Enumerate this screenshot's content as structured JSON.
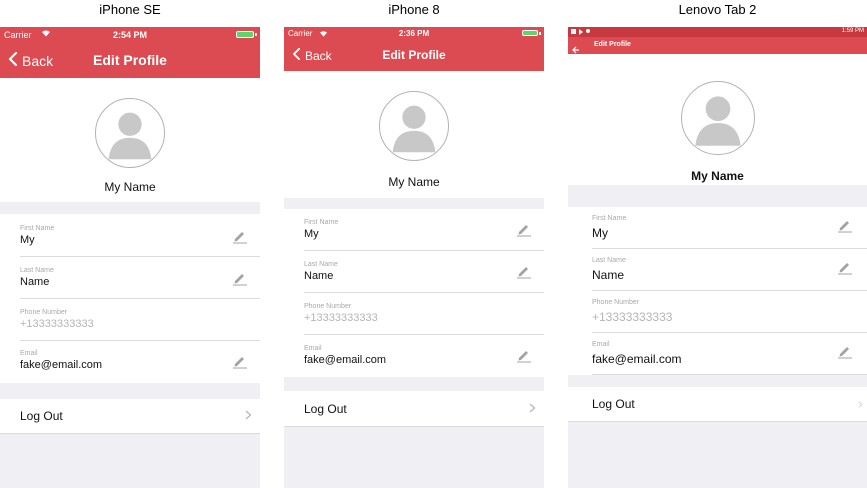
{
  "devices": [
    {
      "name": "iPhone SE",
      "status": {
        "carrier": "Carrier",
        "time": "2:54 PM"
      },
      "nav": {
        "back_label": "Back",
        "title": "Edit Profile"
      },
      "profile_name": "My Name",
      "fields": [
        {
          "label": "First Name",
          "value": "My",
          "editable": true
        },
        {
          "label": "Last Name",
          "value": "Name",
          "editable": true
        },
        {
          "label": "Phone Number",
          "value": "+13333333333",
          "editable": false
        },
        {
          "label": "Email",
          "value": "fake@email.com",
          "editable": true
        }
      ],
      "logout_label": "Log Out"
    },
    {
      "name": "iPhone 8",
      "status": {
        "carrier": "Carrier",
        "time": "2:36 PM"
      },
      "nav": {
        "back_label": "Back",
        "title": "Edit Profile"
      },
      "profile_name": "My Name",
      "fields": [
        {
          "label": "First Name",
          "value": "My",
          "editable": true
        },
        {
          "label": "Last Name",
          "value": "Name",
          "editable": true
        },
        {
          "label": "Phone Number",
          "value": "+13333333333",
          "editable": false
        },
        {
          "label": "Email",
          "value": "fake@email.com",
          "editable": true
        }
      ],
      "logout_label": "Log Out"
    },
    {
      "name": "Lenovo Tab 2",
      "status": {
        "time": "1:59 PM"
      },
      "nav": {
        "title": "Edit Profile"
      },
      "profile_name": "My Name",
      "fields": [
        {
          "label": "First Name",
          "value": "My",
          "editable": true
        },
        {
          "label": "Last Name",
          "value": "Name",
          "editable": true
        },
        {
          "label": "Phone Number",
          "value": "+13333333333",
          "editable": false
        },
        {
          "label": "Email",
          "value": "fake@email.com",
          "editable": true
        }
      ],
      "logout_label": "Log Out"
    }
  ],
  "icons": {
    "back": "chevron-left-icon",
    "edit": "pencil-icon",
    "avatar": "person-icon",
    "logout": "chevron-right-icon"
  },
  "colors": {
    "nav_bar": "#db4b51",
    "android_status_bar": "#c7393f",
    "background": "#efeff4",
    "divider": "#dcdcdc",
    "muted_text": "#a9a9a9"
  }
}
